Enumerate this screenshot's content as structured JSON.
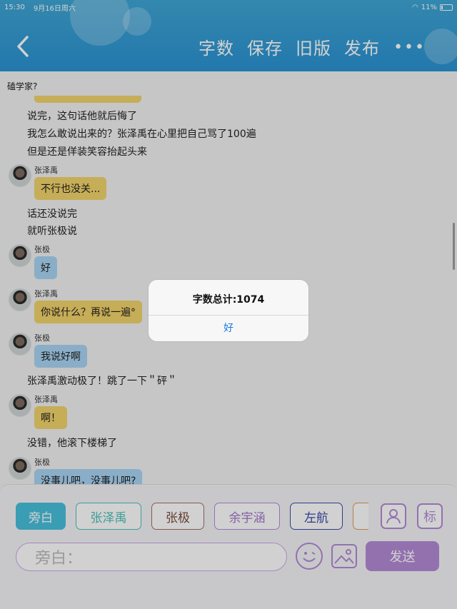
{
  "status": {
    "time": "15:30",
    "date": "9月16日周六",
    "battery": "11%"
  },
  "header": {
    "actions": [
      "字数",
      "保存",
      "旧版",
      "发布"
    ],
    "more": "•••"
  },
  "chat": {
    "top_fragment": "磕学家?",
    "lines": [
      "说完，这句话他就后悔了",
      "我怎么敢说出来的？张泽禹在心里把自己骂了100遍",
      "但是还是佯装笑容抬起头来",
      "话还没说完",
      "就听张极说",
      "张泽禹激动极了！跳了一下＂砰＂",
      "没错，他滚下楼梯了"
    ],
    "messages": [
      {
        "name": "张泽禹",
        "text": "不行也没关..."
      },
      {
        "name": "张极",
        "text": "好"
      },
      {
        "name": "张泽禹",
        "text": "你说什么？再说一遍°"
      },
      {
        "name": "张极",
        "text": "我说好啊"
      },
      {
        "name": "张泽禹",
        "text": "啊！"
      },
      {
        "name": "张极",
        "text": "没事儿吧，没事儿吧?"
      }
    ]
  },
  "alert": {
    "title": "字数总计:1074",
    "ok": "好"
  },
  "panel": {
    "roles": [
      "旁白",
      "张泽禹",
      "张极",
      "余宇涵",
      "左航",
      "..."
    ],
    "biao_label": "标",
    "input_placeholder": "旁白：",
    "send_label": "发送"
  },
  "colors": {
    "header": "#2a93d2",
    "yellow_bubble": "#f2d36b",
    "blue_bubble": "#a9d5f3",
    "accent_purple": "#b48ad6",
    "narration_active": "#49c0dc"
  }
}
